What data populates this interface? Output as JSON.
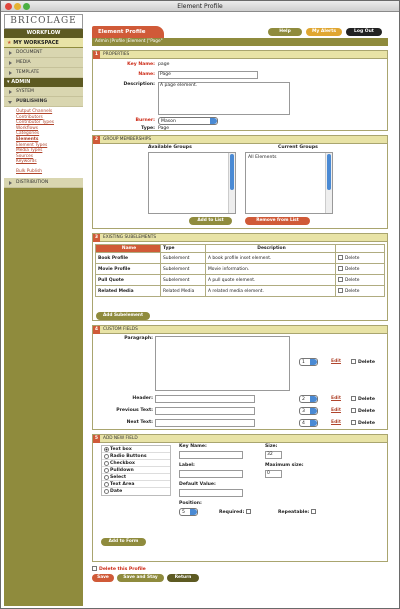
{
  "window": {
    "title": "Element Profile"
  },
  "sidebar": {
    "logo": "BRICOLAGE",
    "workflow_label": "WORKFLOW",
    "my_workspace": "MY WORKSPACE",
    "workflow_items": [
      "DOCUMENT",
      "MEDIA",
      "TEMPLATE"
    ],
    "admin_label": "ADMIN",
    "admin_items": [
      "SYSTEM",
      "PUBLISHING"
    ],
    "publishing_links": [
      "Output Channels",
      "Contributors",
      "Contributor Types",
      "Workflows",
      "Categories",
      "Elements",
      "Element Types",
      "Media Types",
      "Sources",
      "Keywords"
    ],
    "bulk_publish": "Bulk Publish",
    "distribution": "DISTRIBUTION"
  },
  "header": {
    "title": "Element Profile",
    "help": "Help",
    "alerts": "My Alerts",
    "logout": "Log Out",
    "breadcrumb": "Admin |Profile |Element |\"Page\""
  },
  "properties": {
    "number": "1",
    "title": "PROPERTIES",
    "key_name_label": "Key Name:",
    "key_name_value": "page",
    "name_label": "Name:",
    "name_value": "Page",
    "description_label": "Description:",
    "description_value": "A page element.",
    "burner_label": "Burner:",
    "burner_value": "Mason",
    "type_label": "Type:",
    "type_value": "Page"
  },
  "groups": {
    "number": "2",
    "title": "GROUP MEMBERSHIPS",
    "available_label": "Available Groups",
    "current_label": "Current Groups",
    "current_items": [
      "All Elements"
    ],
    "add_button": "Add to List",
    "remove_button": "Remove from List"
  },
  "subelements": {
    "number": "3",
    "title": "EXISTING SUBELEMENTS",
    "columns": [
      "Name",
      "Type",
      "Description"
    ],
    "rows": [
      {
        "name": "Book Profile",
        "type": "Subelement",
        "description": "A book profile inset element.",
        "action": "Delete"
      },
      {
        "name": "Movie Profile",
        "type": "Subelement",
        "description": "Movie information.",
        "action": "Delete"
      },
      {
        "name": "Pull Quote",
        "type": "Subelement",
        "description": "A pull quote element.",
        "action": "Delete"
      },
      {
        "name": "Related Media",
        "type": "Related Media",
        "description": "A related media element.",
        "action": "Delete"
      }
    ],
    "add_button": "Add Subelement"
  },
  "custom_fields": {
    "number": "4",
    "title": "CUSTOM FIELDS",
    "fields": [
      {
        "label": "Paragraph:",
        "order": "1",
        "edit": "Edit",
        "delete": "Delete"
      },
      {
        "label": "Header:",
        "order": "2",
        "edit": "Edit",
        "delete": "Delete"
      },
      {
        "label": "Previous Text:",
        "order": "3",
        "edit": "Edit",
        "delete": "Delete"
      },
      {
        "label": "Next Text:",
        "order": "4",
        "edit": "Edit",
        "delete": "Delete"
      }
    ]
  },
  "add_field": {
    "number": "5",
    "title": "ADD NEW FIELD",
    "types": [
      "Text box",
      "Radio Buttons",
      "Checkbox",
      "Pulldown",
      "Select",
      "Text Area",
      "Date"
    ],
    "selected_type": "Text box",
    "key_name_label": "Key Name:",
    "label_label": "Label:",
    "default_label": "Default Value:",
    "size_label": "Size:",
    "size_value": "32",
    "max_size_label": "Maximum size:",
    "max_size_value": "0",
    "position_label": "Position:",
    "position_value": "5",
    "required_label": "Required:",
    "repeatable_label": "Repeatable:",
    "add_button": "Add to Form"
  },
  "footer": {
    "delete_profile": "Delete this Profile",
    "save": "Save",
    "save_stay": "Save and Stay",
    "return": "Return"
  },
  "colors": {
    "accent": "#d05a38",
    "olive": "#8f8b3d",
    "link": "#b0452d"
  }
}
